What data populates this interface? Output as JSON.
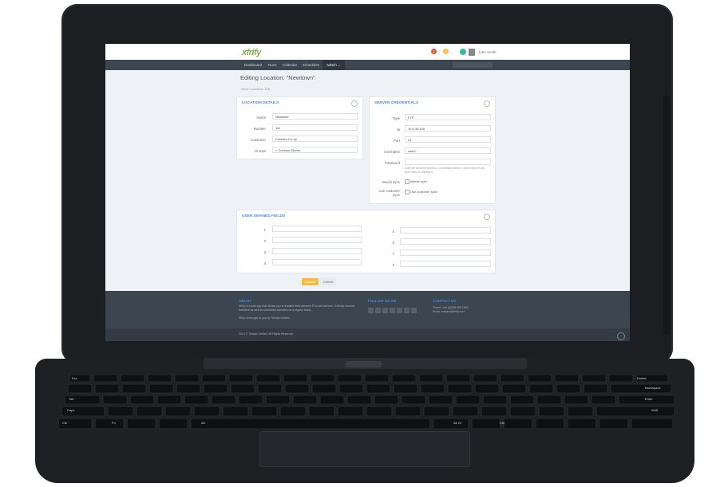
{
  "app": {
    "logo": "xfrify",
    "notifications": [
      "1",
      "0"
    ],
    "user_name": "John Smith"
  },
  "nav": {
    "items": [
      "Dashboard",
      "Runs",
      "Calendar",
      "Schedules"
    ],
    "admin_label": "Admin ⌄"
  },
  "page": {
    "title": "Editing Location: \"Newtown\"",
    "breadcrumb": "Home  /  Locations  /  Edit"
  },
  "location_details": {
    "title": "LOCATION DETAILS",
    "fields": [
      {
        "label": "Name",
        "value": "Newtown"
      },
      {
        "label": "Number",
        "value": "111"
      },
      {
        "label": "Customer",
        "value": "Contoso Co-op"
      },
      {
        "label": "Groups",
        "value": "× Contoso Stores"
      }
    ]
  },
  "server_credentials": {
    "title": "SERVER CREDENTIALS",
    "type_label": "Type",
    "type_value": "FTP",
    "ip_label": "Ip",
    "ip_value": "10.6.35.100",
    "port_label": "Port",
    "port_value": "21",
    "username_label": "Username",
    "username_value": "user1",
    "password_label": "Password",
    "password_hint": "It will be securely stored in Credentials server. Leave blank if you don't want to change it.",
    "needs_sync_label": "Needs sync",
    "needs_sync_text": "Needs sync",
    "use_customer_sync_label": "Use customer sync",
    "use_customer_sync_text": "Use customer sync"
  },
  "user_defined_fields": {
    "title": "USER DEFINED FIELDS",
    "left": [
      "1",
      "2",
      "3",
      "4"
    ],
    "right": [
      "5",
      "6",
      "7",
      "8"
    ]
  },
  "actions": {
    "update": "Update",
    "cancel": "Cancel"
  },
  "footer": {
    "about_title": "ABOUT",
    "about_text": "Xfrify is a web app that allows you to transfer files between PCs and servers. It allows manual transfers as well as scheduled transfers on a regular basis.",
    "about_credit": "Xfrify is brought to you by Tolmac Limited.",
    "follow_title": "FOLLOW US ON",
    "contact_title": "CONTACT US",
    "contact_phone": "Phone: +44 (0)208 088 1682",
    "contact_email": "Email: contact@xfrify.com",
    "copyright": "2014 © Tolmac Limited. All Rights Reserved."
  },
  "keyboard": {
    "labels": [
      "Esc",
      "Backspace",
      "Tab",
      "Enter",
      "Caps",
      "Shift",
      "Ctrl",
      "Fn",
      "Alt",
      "Alt Gr",
      "Ctrl",
      "Delete"
    ]
  },
  "colors": {
    "accent": "#4a89dc",
    "nav": "#3b4650",
    "update": "#f6bb42",
    "logo": "#7cb342"
  }
}
